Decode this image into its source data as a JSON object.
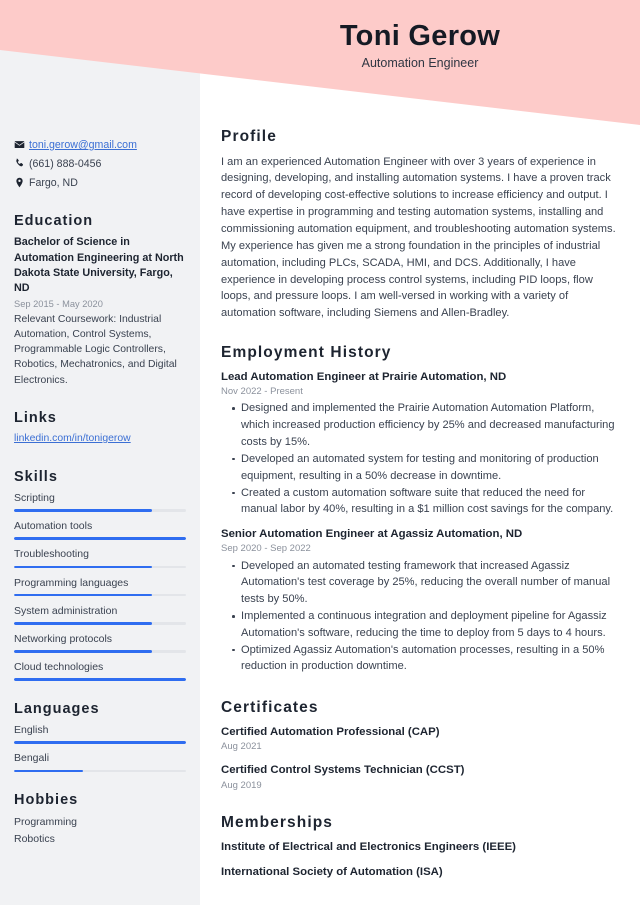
{
  "header": {
    "name": "Toni Gerow",
    "job_title": "Automation Engineer",
    "background_color": "#fdcbc9"
  },
  "theme": {
    "accent_color": "#2f6df0",
    "link_color": "#3b6fd4",
    "sidebar_background": "#f1f2f4",
    "heading_color": "#1d2430",
    "muted_text_color": "#8b919c"
  },
  "sidebar": {
    "contact": [
      {
        "icon": "envelope-icon",
        "text": "toni.gerow@gmail.com",
        "is_link": true
      },
      {
        "icon": "phone-icon",
        "text": "(661) 888-0456",
        "is_link": false
      },
      {
        "icon": "location-pin-icon",
        "text": "Fargo, ND",
        "is_link": false
      }
    ],
    "education": {
      "title": "Education",
      "degree": "Bachelor of Science in Automation Engineering at North Dakota State University, Fargo, ND",
      "date": "Sep 2015 - May 2020",
      "description": "Relevant Coursework: Industrial Automation, Control Systems, Programmable Logic Controllers, Robotics, Mechatronics, and Digital Electronics."
    },
    "links": {
      "title": "Links",
      "items": [
        {
          "label": "linkedin.com/in/tonigerow"
        }
      ]
    },
    "skills": {
      "title": "Skills",
      "items": [
        {
          "label": "Scripting",
          "level": 80
        },
        {
          "label": "Automation tools",
          "level": 100
        },
        {
          "label": "Troubleshooting",
          "level": 80
        },
        {
          "label": "Programming languages",
          "level": 80
        },
        {
          "label": "System administration",
          "level": 80
        },
        {
          "label": "Networking protocols",
          "level": 80
        },
        {
          "label": "Cloud technologies",
          "level": 100
        }
      ]
    },
    "languages": {
      "title": "Languages",
      "items": [
        {
          "label": "English",
          "level": 100
        },
        {
          "label": "Bengali",
          "level": 40
        }
      ]
    },
    "hobbies": {
      "title": "Hobbies",
      "items": [
        {
          "label": "Programming"
        },
        {
          "label": "Robotics"
        }
      ]
    }
  },
  "main": {
    "profile": {
      "title": "Profile",
      "text": "I am an experienced Automation Engineer with over 3 years of experience in designing, developing, and installing automation systems. I have a proven track record of developing cost-effective solutions to increase efficiency and output. I have expertise in programming and testing automation systems, installing and commissioning automation equipment, and troubleshooting automation systems. My experience has given me a strong foundation in the principles of industrial automation, including PLCs, SCADA, HMI, and DCS. Additionally, I have experience in developing process control systems, including PID loops, flow loops, and pressure loops. I am well-versed in working with a variety of automation software, including Siemens and Allen-Bradley."
    },
    "employment": {
      "title": "Employment History",
      "jobs": [
        {
          "heading": "Lead Automation Engineer at Prairie Automation, ND",
          "date": "Nov 2022 - Present",
          "bullets": [
            "Designed and implemented the Prairie Automation Automation Platform, which increased production efficiency by 25% and decreased manufacturing costs by 15%.",
            "Developed an automated system for testing and monitoring of production equipment, resulting in a 50% decrease in downtime.",
            "Created a custom automation software suite that reduced the need for manual labor by 40%, resulting in a $1 million cost savings for the company."
          ]
        },
        {
          "heading": "Senior Automation Engineer at Agassiz Automation, ND",
          "date": "Sep 2020 - Sep 2022",
          "bullets": [
            "Developed an automated testing framework that increased Agassiz Automation's test coverage by 25%, reducing the overall number of manual tests by 50%.",
            "Implemented a continuous integration and deployment pipeline for Agassiz Automation's software, reducing the time to deploy from 5 days to 4 hours.",
            "Optimized Agassiz Automation's automation processes, resulting in a 50% reduction in production downtime."
          ]
        }
      ]
    },
    "certificates": {
      "title": "Certificates",
      "items": [
        {
          "name": "Certified Automation Professional (CAP)",
          "date": "Aug 2021"
        },
        {
          "name": "Certified Control Systems Technician (CCST)",
          "date": "Aug 2019"
        }
      ]
    },
    "memberships": {
      "title": "Memberships",
      "items": [
        {
          "name": "Institute of Electrical and Electronics Engineers (IEEE)"
        },
        {
          "name": "International Society of Automation (ISA)"
        }
      ]
    }
  }
}
